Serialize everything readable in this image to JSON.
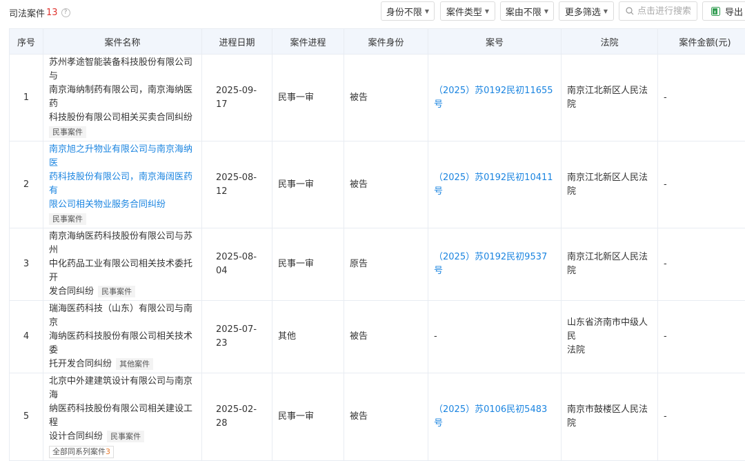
{
  "header": {
    "title": "司法案件",
    "count": "13",
    "help_icon": "question-circle-icon"
  },
  "toolbar": {
    "filters": [
      {
        "label": "身份不限"
      },
      {
        "label": "案件类型"
      },
      {
        "label": "案由不限"
      },
      {
        "label": "更多筛选"
      }
    ],
    "search_placeholder": "点击进行搜索",
    "export_label": "导出"
  },
  "table": {
    "columns": [
      "序号",
      "案件名称",
      "进程日期",
      "案件进程",
      "案件身份",
      "案号",
      "法院",
      "案件金额(元)"
    ],
    "rows": [
      {
        "no": "1",
        "name_lines": [
          "苏州孝途智能装备科技股份有限公司与",
          "南京海纳制药有限公司，南京海纳医药",
          "科技股份有限公司相关买卖合同纠纷"
        ],
        "tag": "民事案件",
        "date": "2025-09-17",
        "stage": "民事一审",
        "role": "被告",
        "case_no": "（2025）苏0192民初11655号",
        "court": "南京江北新区人民法院",
        "amount": "-"
      },
      {
        "no": "2",
        "name_lines": [
          "南京旭之升物业有限公司与南京海纳医",
          "药科技股份有限公司，南京海阔医药有",
          "限公司相关物业服务合同纠纷"
        ],
        "tag": "民事案件",
        "date": "2025-08-12",
        "stage": "民事一审",
        "role": "被告",
        "case_no": "（2025）苏0192民初10411号",
        "court": "南京江北新区人民法院",
        "amount": "-"
      },
      {
        "no": "3",
        "name_lines": [
          "南京海纳医药科技股份有限公司与苏州",
          "中化药品工业有限公司相关技术委托开",
          "发合同纠纷"
        ],
        "tag": "民事案件",
        "date": "2025-08-04",
        "stage": "民事一审",
        "role": "原告",
        "case_no": "（2025）苏0192民初9537号",
        "court": "南京江北新区人民法院",
        "amount": "-"
      },
      {
        "no": "4",
        "name_lines": [
          "瑞海医药科技（山东）有限公司与南京",
          "海纳医药科技股份有限公司相关技术委",
          "托开发合同纠纷"
        ],
        "tag": "其他案件",
        "date": "2025-07-23",
        "stage": "其他",
        "role": "被告",
        "case_no": "-",
        "court_lines": [
          "山东省济南市中级人民",
          "法院"
        ],
        "amount": "-"
      },
      {
        "no": "5",
        "name_lines": [
          "北京中外建建筑设计有限公司与南京海",
          "纳医药科技股份有限公司相关建设工程",
          "设计合同纠纷"
        ],
        "tag": "民事案件",
        "series_label": "全部同系列案件",
        "series_count": "3",
        "date": "2025-02-28",
        "stage": "民事一审",
        "role": "被告",
        "case_no": "（2025）苏0106民初5483号",
        "court": "南京市鼓楼区人民法院",
        "amount": "-"
      }
    ]
  },
  "colors": {
    "link": "#1a84e0",
    "count_red": "#e0332e",
    "series_orange": "#e97a2b",
    "header_bg": "#f2f6fc"
  }
}
